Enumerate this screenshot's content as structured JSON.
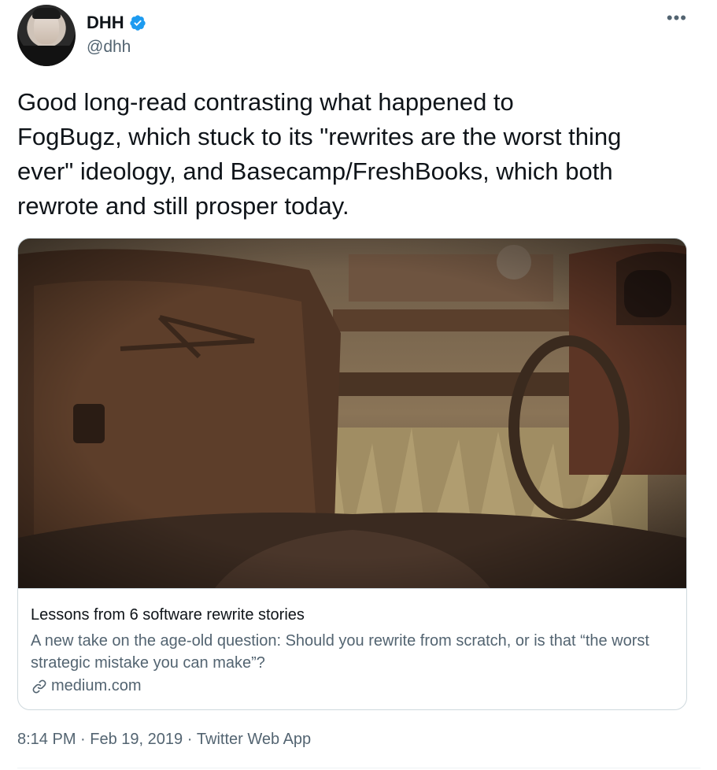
{
  "author": {
    "display_name": "DHH",
    "handle": "@dhh",
    "verified": true
  },
  "more_icon": "more-horizontal-icon",
  "tweet": {
    "text": "Good long-read contrasting what happened to\nFogBugz, which stuck to its \"rewrites are the worst thing\never\" ideology, and Basecamp/FreshBooks, which both\nrewrote and still prosper today."
  },
  "card": {
    "title": "Lessons from 6 software rewrite stories",
    "description": "A new take on the age-old question: Should you rewrite from scratch, or is that “the worst strategic mistake you can make”?",
    "domain": "medium.com",
    "domain_icon": "link-icon"
  },
  "meta": {
    "time": "8:14 PM",
    "separator": " · ",
    "date": "Feb 19, 2019",
    "source": "Twitter Web App"
  },
  "colors": {
    "verified_blue": "#1d9bf0",
    "secondary_text": "#536471",
    "border": "#cfd9de"
  }
}
